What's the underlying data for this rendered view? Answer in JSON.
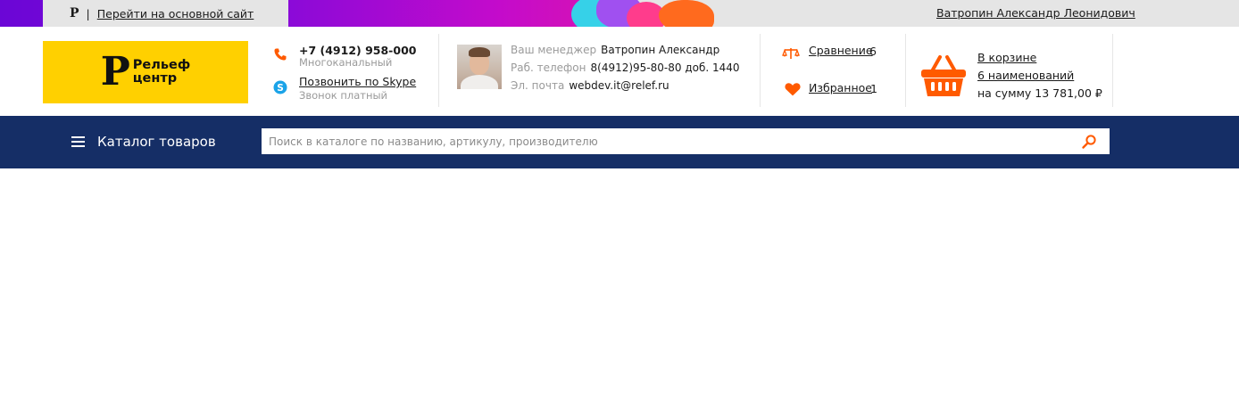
{
  "topbar": {
    "logo_mark": "Р",
    "separator": "|",
    "main_site_link": "Перейти на основной сайт",
    "user_name": "Ватропин Александр Леонидович"
  },
  "logo": {
    "mark": "Р",
    "line1": "Рельеф",
    "line2": "центр",
    "bg_color": "#ffd000"
  },
  "contacts": {
    "phone": "+7 (4912) 958-000",
    "phone_note": "Многоканальный",
    "skype_link": "Позвонить по Skype",
    "skype_note": "Звонок платный",
    "phone_icon": "phone-icon",
    "skype_icon": "skype-icon"
  },
  "manager": {
    "rows": [
      {
        "label": "Ваш менеджер",
        "value": "Ватропин Александр"
      },
      {
        "label": "Раб. телефон",
        "value": "8(4912)95-80-80 доб. 1440"
      },
      {
        "label": "Эл. почта",
        "value": "webdev.it@relef.ru"
      }
    ]
  },
  "compare": {
    "label": "Сравнение",
    "count": "6",
    "icon": "scales-icon"
  },
  "favorites": {
    "label": "Избранное",
    "count": "1",
    "icon": "heart-icon"
  },
  "cart": {
    "line1": "В корзине",
    "line2": "6 наименований",
    "line3": "на сумму 13 781,00 ₽",
    "icon": "basket-icon"
  },
  "nav": {
    "catalog_label": "Каталог товаров",
    "search_placeholder": "Поиск в каталоге по названию, артикулу, производителю",
    "bar_color": "#152e66",
    "accent_color": "#ff5a00"
  }
}
